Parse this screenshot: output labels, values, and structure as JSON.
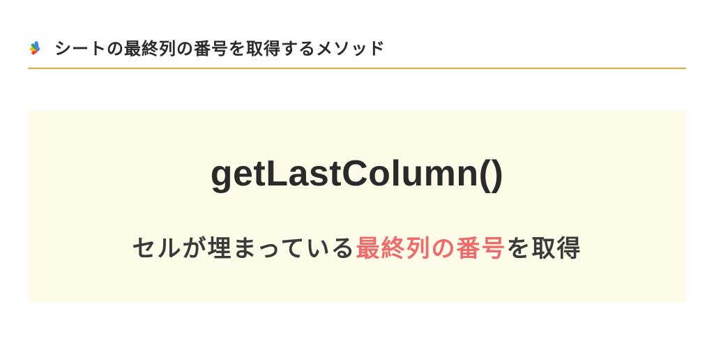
{
  "header": {
    "title": "シートの最終列の番号を取得するメソッド"
  },
  "content": {
    "method_name": "getLastColumn()",
    "desc_prefix": "セルが埋まっている",
    "desc_highlight": "最終列の番号",
    "desc_suffix": "を取得"
  }
}
